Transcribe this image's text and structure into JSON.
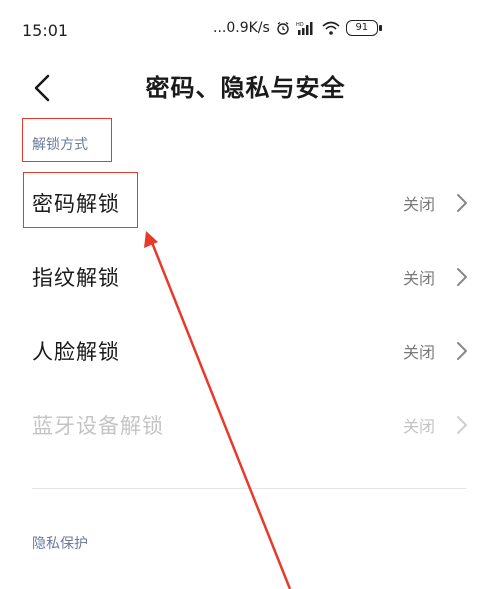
{
  "status_bar": {
    "time": "15:01",
    "network_speed": "...0.9K/s",
    "battery_level": "91"
  },
  "header": {
    "title": "密码、隐私与安全"
  },
  "sections": {
    "unlock": {
      "label": "解锁方式",
      "items": [
        {
          "label": "密码解锁",
          "value": "关闭"
        },
        {
          "label": "指纹解锁",
          "value": "关闭"
        },
        {
          "label": "人脸解锁",
          "value": "关闭"
        },
        {
          "label": "蓝牙设备解锁",
          "value": "关闭"
        }
      ]
    },
    "privacy": {
      "label": "隐私保护"
    }
  },
  "colors": {
    "annotation": "#e8392b",
    "section_label": "#6c7b9c",
    "disabled_text": "#c4c4c4"
  }
}
